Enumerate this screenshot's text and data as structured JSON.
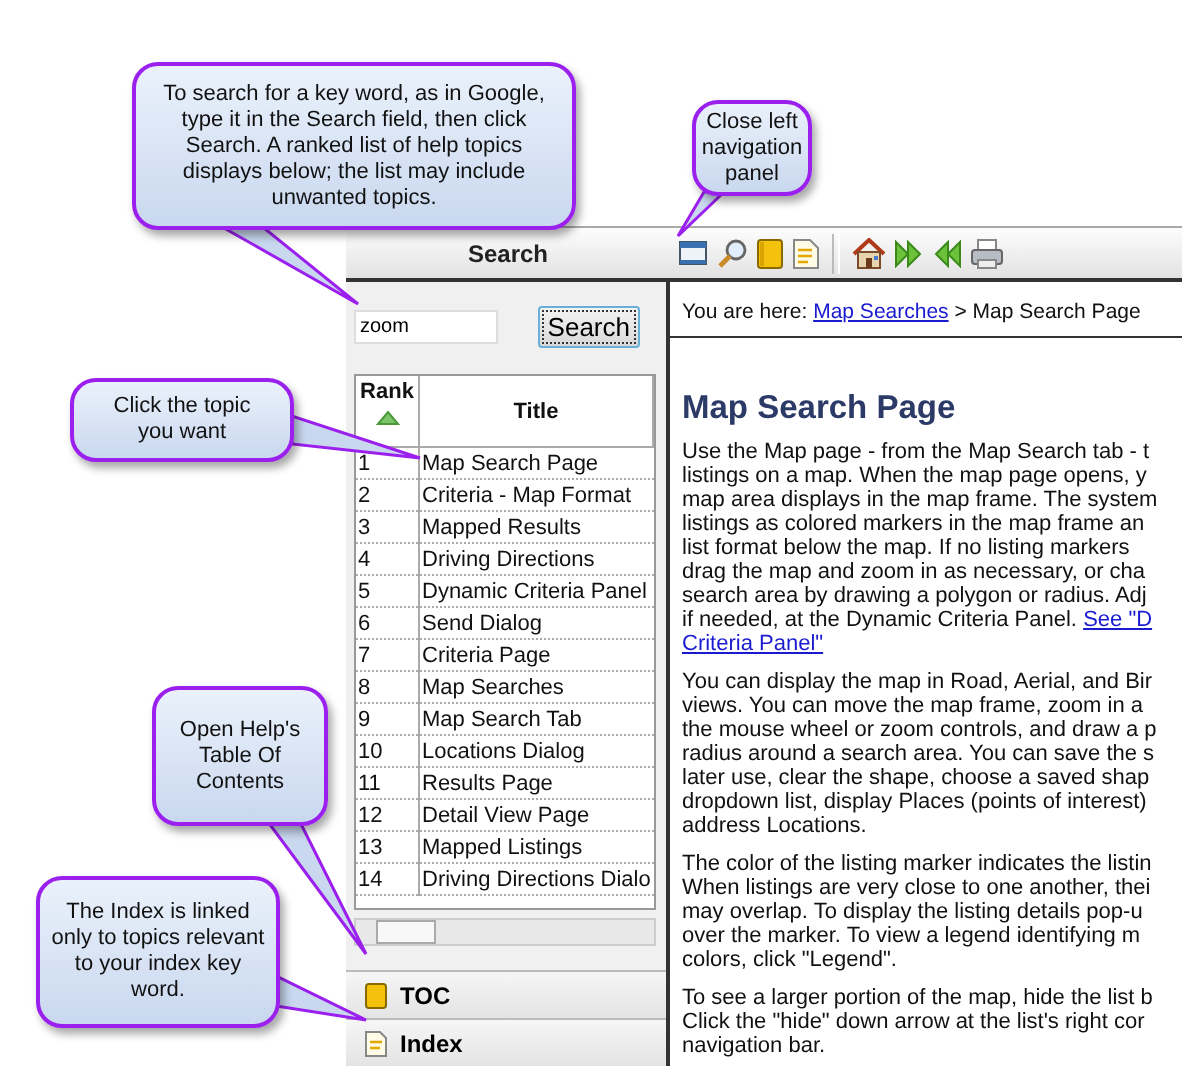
{
  "header": {
    "title": "Search"
  },
  "search": {
    "value": "zoom",
    "button": "Search"
  },
  "table": {
    "columns": [
      {
        "label": "Rank",
        "sorted": true
      },
      {
        "label": "Title",
        "sorted": false
      }
    ],
    "rows": [
      {
        "rank": "1",
        "title": "Map Search Page"
      },
      {
        "rank": "2",
        "title": "Criteria - Map Format"
      },
      {
        "rank": "3",
        "title": "Mapped Results"
      },
      {
        "rank": "4",
        "title": "Driving Directions"
      },
      {
        "rank": "5",
        "title": "Dynamic Criteria Panel"
      },
      {
        "rank": "6",
        "title": "Send Dialog"
      },
      {
        "rank": "7",
        "title": "Criteria Page"
      },
      {
        "rank": "8",
        "title": "Map Searches"
      },
      {
        "rank": "9",
        "title": "Map Search Tab"
      },
      {
        "rank": "10",
        "title": "Locations Dialog"
      },
      {
        "rank": "11",
        "title": "Results Page"
      },
      {
        "rank": "12",
        "title": "Detail View Page"
      },
      {
        "rank": "13",
        "title": "Mapped Listings"
      },
      {
        "rank": "14",
        "title": "Driving Directions Dialo"
      }
    ]
  },
  "nav_tabs": [
    {
      "kind": "toc",
      "label": "TOC"
    },
    {
      "kind": "index",
      "label": "Index"
    }
  ],
  "breadcrumb": {
    "prefix": "You are here:",
    "link": "Map Searches",
    "separator": ">",
    "current": "Map Search Page"
  },
  "content": {
    "title": "Map Search Page",
    "paragraphs": [
      {
        "lines": [
          "Use the Map page - from the Map Search tab - t",
          "listings on a map. When the map page opens, y",
          "map area displays in the map frame. The system",
          "listings as colored markers in the map frame an",
          "list format below the map. If no listing markers",
          "drag the map and zoom in as necessary, or cha",
          "search area by drawing a polygon or radius. Adj",
          "if needed, at the Dynamic Criteria Panel."
        ],
        "link": [
          "See \"D",
          "Criteria Panel\""
        ]
      },
      {
        "lines": [
          "You can display the map in Road, Aerial, and Bir",
          "views. You can move the map frame, zoom in a",
          "the mouse wheel or zoom controls, and draw a p",
          "radius around a search area. You can save the s",
          "later use, clear the shape, choose a saved shap",
          "dropdown list, display Places (points of interest)",
          "address Locations."
        ]
      },
      {
        "lines": [
          "The color of the listing marker indicates the listin",
          "When listings are very close to one another, thei",
          "may overlap. To display the listing details pop-u",
          "over the marker. To view a legend identifying m",
          "colors, click \"Legend\"."
        ]
      },
      {
        "lines": [
          "To see a larger portion of the map, hide the list b",
          "Click the \"hide\" down arrow at the list's right cor",
          "navigation bar."
        ]
      }
    ]
  },
  "callouts": [
    {
      "text": "To search for a key word, as in Google, type it in the Search field, then click Search. A ranked list of help topics displays below; the list may include unwanted topics."
    },
    {
      "text": "Close left navigation panel"
    },
    {
      "text": "Click the topic you want"
    },
    {
      "text": "Open Help's Table Of Contents"
    },
    {
      "text": "The Index is linked only to topics relevant to your index key word."
    }
  ]
}
